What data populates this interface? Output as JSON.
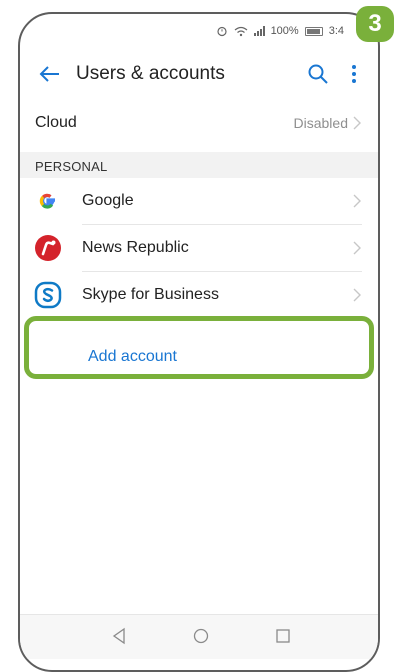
{
  "status_bar": {
    "battery_percent": "100%",
    "time": "3:4"
  },
  "toolbar": {
    "title": "Users & accounts"
  },
  "cloud": {
    "label": "Cloud",
    "value": "Disabled"
  },
  "section": {
    "title": "PERSONAL"
  },
  "accounts": [
    {
      "label": "Google",
      "icon": "google-icon"
    },
    {
      "label": "News Republic",
      "icon": "news-republic-icon"
    },
    {
      "label": "Skype for Business",
      "icon": "skype-icon"
    }
  ],
  "add_account": {
    "label": "Add account"
  },
  "step_badge": {
    "number": "3"
  },
  "colors": {
    "accent": "#1976d2",
    "highlight": "#7ab03b"
  }
}
